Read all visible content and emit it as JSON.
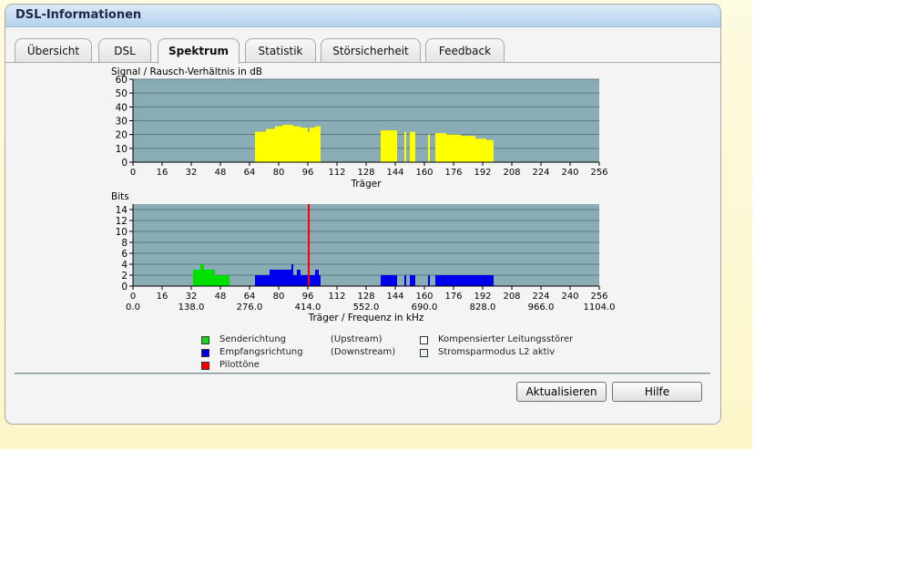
{
  "window": {
    "title": "DSL-Informationen"
  },
  "tabs": [
    {
      "label": "Übersicht",
      "active": false
    },
    {
      "label": "DSL",
      "active": false
    },
    {
      "label": "Spektrum",
      "active": true
    },
    {
      "label": "Statistik",
      "active": false
    },
    {
      "label": "Störsicherheit",
      "active": false
    },
    {
      "label": "Feedback",
      "active": false
    }
  ],
  "chart_data": [
    {
      "type": "bar",
      "title": "Signal / Rausch-Verhältnis in dB",
      "xlabel": "Träger",
      "ylabel": "",
      "xlim": [
        0,
        256
      ],
      "ylim": [
        0,
        60
      ],
      "x_ticks": [
        0,
        16,
        32,
        48,
        64,
        80,
        96,
        112,
        128,
        144,
        160,
        176,
        192,
        208,
        224,
        240,
        256
      ],
      "y_ticks": [
        0,
        10,
        20,
        30,
        40,
        50,
        60
      ],
      "grid": true,
      "background_color": "#8aacb4",
      "series": [
        {
          "color": "#ffff00",
          "segments": [
            {
              "x_start": 67,
              "x_end": 73,
              "value": 22
            },
            {
              "x_start": 73,
              "x_end": 78,
              "value": 24
            },
            {
              "x_start": 78,
              "x_end": 82,
              "value": 26
            },
            {
              "x_start": 82,
              "x_end": 88,
              "value": 27
            },
            {
              "x_start": 88,
              "x_end": 92,
              "value": 26
            },
            {
              "x_start": 92,
              "x_end": 96,
              "value": 25
            },
            {
              "x_start": 96,
              "x_end": 97,
              "value": 22
            },
            {
              "x_start": 97,
              "x_end": 100,
              "value": 25
            },
            {
              "x_start": 100,
              "x_end": 103,
              "value": 26
            },
            {
              "x_start": 136,
              "x_end": 145,
              "value": 23
            },
            {
              "x_start": 149,
              "x_end": 150,
              "value": 22
            },
            {
              "x_start": 152,
              "x_end": 155,
              "value": 22
            },
            {
              "x_start": 162,
              "x_end": 163,
              "value": 20
            },
            {
              "x_start": 166,
              "x_end": 172,
              "value": 21
            },
            {
              "x_start": 172,
              "x_end": 180,
              "value": 20
            },
            {
              "x_start": 180,
              "x_end": 188,
              "value": 19
            },
            {
              "x_start": 188,
              "x_end": 194,
              "value": 17
            },
            {
              "x_start": 194,
              "x_end": 198,
              "value": 16
            }
          ]
        }
      ]
    },
    {
      "type": "bar",
      "title": "Bits",
      "xlabel": "Träger / Frequenz in kHz",
      "ylabel": "",
      "xlim": [
        0,
        256
      ],
      "ylim": [
        0,
        15
      ],
      "x_ticks": [
        0,
        16,
        32,
        48,
        64,
        80,
        96,
        112,
        128,
        144,
        160,
        176,
        192,
        208,
        224,
        240,
        256
      ],
      "x_ticks_secondary": [
        "0.0",
        "138.0",
        "276.0",
        "414.0",
        "552.0",
        "690.0",
        "828.0",
        "966.0",
        "1104.0"
      ],
      "y_ticks": [
        0,
        2,
        4,
        6,
        8,
        10,
        12,
        14
      ],
      "grid": true,
      "background_color": "#8aacb4",
      "series": [
        {
          "name": "Senderichtung",
          "color": "#00e000",
          "segments": [
            {
              "x_start": 33,
              "x_end": 37,
              "value": 3
            },
            {
              "x_start": 37,
              "x_end": 39,
              "value": 4
            },
            {
              "x_start": 39,
              "x_end": 45,
              "value": 3
            },
            {
              "x_start": 45,
              "x_end": 53,
              "value": 2
            }
          ]
        },
        {
          "name": "Empfangsrichtung",
          "color": "#0000ee",
          "segments": [
            {
              "x_start": 67,
              "x_end": 75,
              "value": 2
            },
            {
              "x_start": 75,
              "x_end": 87,
              "value": 3
            },
            {
              "x_start": 87,
              "x_end": 88,
              "value": 4
            },
            {
              "x_start": 88,
              "x_end": 90,
              "value": 2
            },
            {
              "x_start": 90,
              "x_end": 92,
              "value": 3
            },
            {
              "x_start": 92,
              "x_end": 100,
              "value": 2
            },
            {
              "x_start": 100,
              "x_end": 102,
              "value": 3
            },
            {
              "x_start": 102,
              "x_end": 103,
              "value": 2
            },
            {
              "x_start": 136,
              "x_end": 145,
              "value": 2
            },
            {
              "x_start": 149,
              "x_end": 150,
              "value": 2
            },
            {
              "x_start": 152,
              "x_end": 155,
              "value": 2
            },
            {
              "x_start": 162,
              "x_end": 163,
              "value": 2
            },
            {
              "x_start": 166,
              "x_end": 198,
              "value": 2
            }
          ]
        },
        {
          "name": "Pilottöne",
          "color": "#ff0000",
          "segments": [
            {
              "x_start": 96,
              "x_end": 97,
              "value": 15
            }
          ]
        }
      ]
    }
  ],
  "legend": {
    "send": {
      "label": "Senderichtung",
      "direction": "(Upstream)",
      "color": "#22cc22"
    },
    "receive": {
      "label": "Empfangsrichtung",
      "direction": "(Downstream)",
      "color": "#0000dd"
    },
    "pilot": {
      "label": "Pilottöne",
      "color": "#ee0000"
    },
    "compensated": {
      "label": "Kompensierter Leitungsstörer",
      "color": "#ffffff"
    },
    "l2": {
      "label": "Stromsparmodus L2 aktiv",
      "color": "#e6f0f0"
    }
  },
  "buttons": {
    "refresh": "Aktualisieren",
    "help": "Hilfe"
  }
}
